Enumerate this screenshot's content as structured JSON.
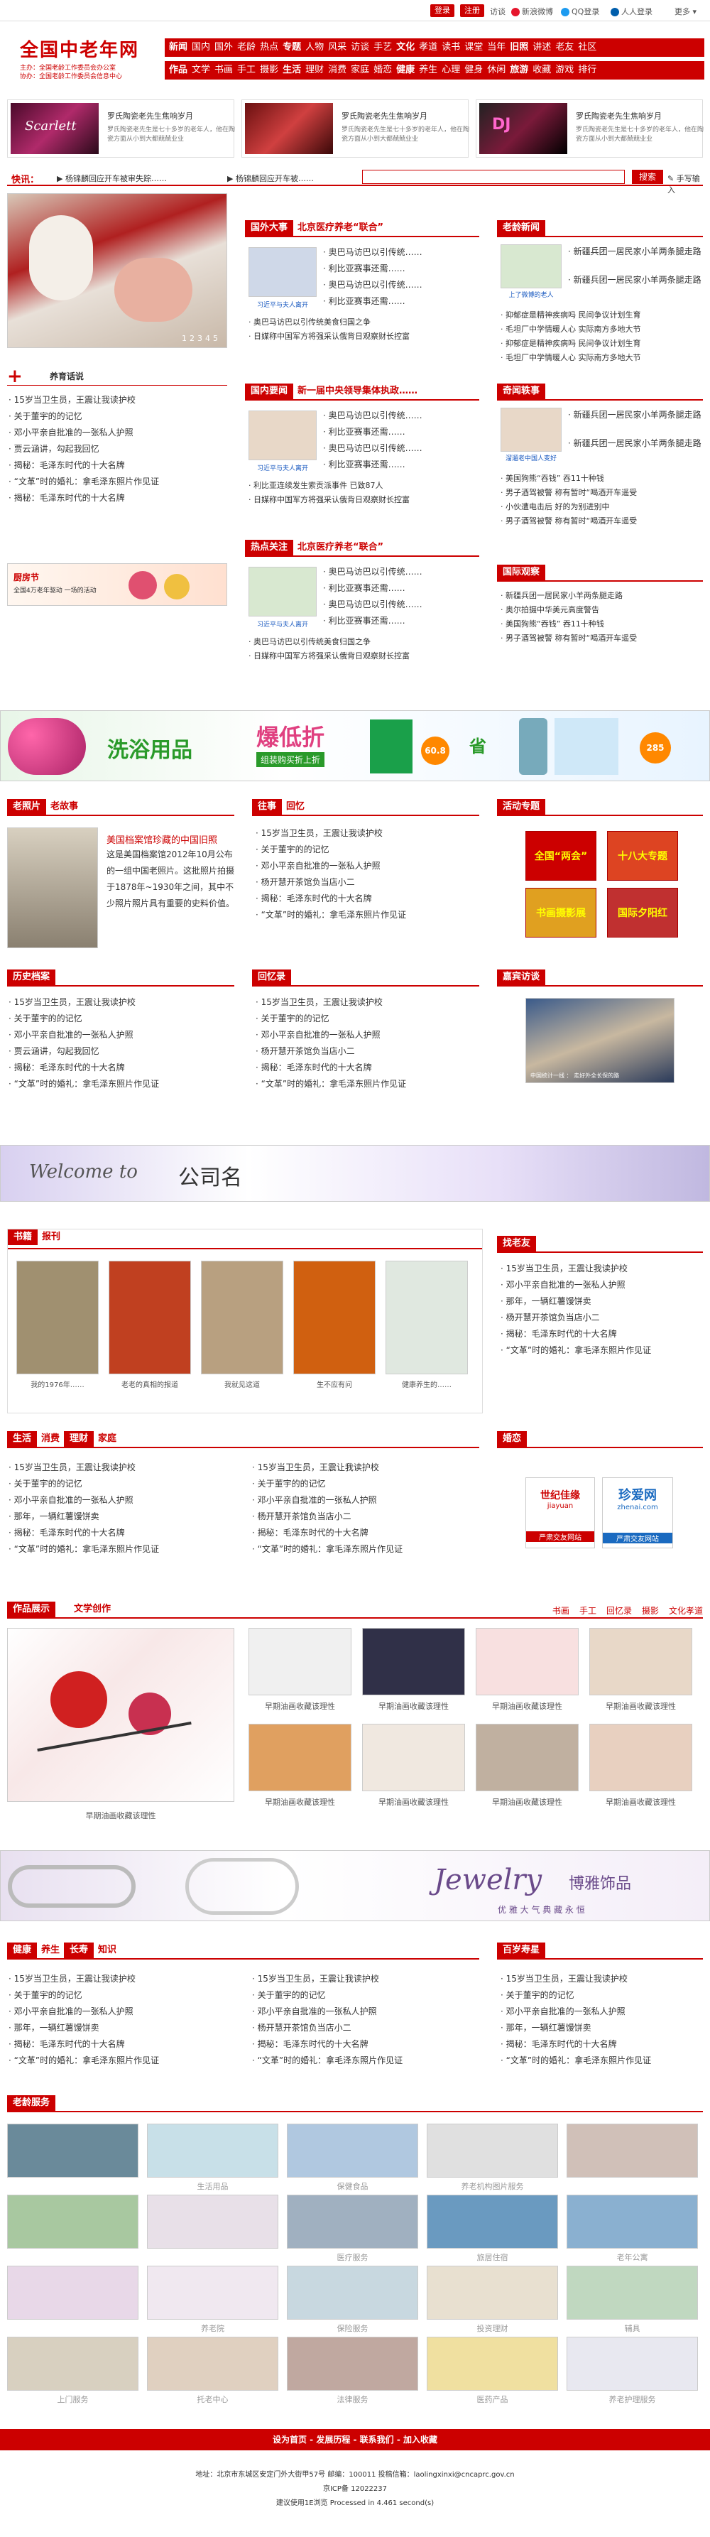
{
  "top": {
    "login": "登录",
    "register": "注册",
    "visit": "访谈",
    "sina": "新浪微博",
    "qq": "QQ登录",
    "renren": "人人登录",
    "more": "更多"
  },
  "logo": {
    "title": "全国中老年网",
    "sub1": "主办：全国老龄工作委员会办公室",
    "sub2": "协办：全国老龄工作委员会信息中心"
  },
  "nav": {
    "row1": [
      "新闻",
      "国内",
      "国外",
      "老龄",
      "热点",
      "专题",
      "人物",
      "风采",
      "访谈",
      "手艺",
      "文化",
      "孝道",
      "读书",
      "课堂",
      "当年",
      "旧照",
      "讲述",
      "老友",
      "社区"
    ],
    "row2": [
      "作品",
      "文学",
      "书画",
      "手工",
      "摄影",
      "生活",
      "理财",
      "消费",
      "家庭",
      "婚恋",
      "健康",
      "养生",
      "心理",
      "健身",
      "休闲",
      "旅游",
      "收藏",
      "游戏",
      "排行"
    ]
  },
  "banners": [
    {
      "title": "罗氏陶瓷老先生焦响岁月",
      "desc": "罗氏陶瓷老先生是七十多岁的老年人，他在陶瓷方面从小到大都兢兢业业"
    },
    {
      "title": "罗氏陶瓷老先生焦响岁月",
      "desc": "罗氏陶瓷老先生是七十多岁的老年人，他在陶瓷方面从小到大都兢兢业业"
    },
    {
      "title": "罗氏陶瓷老先生焦响岁月",
      "desc": "罗氏陶瓷老先生是七十多岁的老年人，他在陶瓷方面从小到大都兢兢业业"
    }
  ],
  "quick": {
    "label": "快讯：",
    "items": [
      "杨锦麟回应开车被审失踪……",
      "杨锦麟回应开车被……"
    ],
    "search": "搜索",
    "handwrite": "手写输入"
  },
  "slider": {
    "pages": [
      "1",
      "2",
      "3",
      "4",
      "5"
    ]
  },
  "col2": {
    "s1": {
      "tag": "国外大事",
      "title": "北京医疗养老“联合”",
      "items": [
        "奥巴马访巴以引传统……",
        "利比亚赛事还需……",
        "奥巴马访巴以引传统……",
        "利比亚赛事还需……"
      ],
      "cap": "习近平与夫人离开",
      "list": [
        "奥巴马访巴以引传统美食归国之争",
        "日媒称中国军方将强采认俄背日观察财长控富"
      ]
    },
    "s2": {
      "tag": "国内要闻",
      "title": "新一届中央领导集体执政……",
      "items": [
        "奥巴马访巴以引传统……",
        "利比亚赛事还需……",
        "奥巴马访巴以引传统……",
        "利比亚赛事还需……"
      ],
      "cap": "习近平与夫人离开",
      "list": [
        "利比亚连续发生索贡派事件 已致87人",
        "日媒称中国军方将强采认俄背日观察财长控富"
      ]
    },
    "s3": {
      "tag": "热点关注",
      "title": "北京医疗养老“联合”",
      "items": [
        "奥巴马访巴以引传统……",
        "利比亚赛事还需……",
        "奥巴马访巴以引传统……",
        "利比亚赛事还需……"
      ],
      "cap": "习近平与夫人离开",
      "list": [
        "奥巴马访巴以引传统美食归国之争",
        "日媒称中国军方将强采认俄背日观察财长控富"
      ]
    }
  },
  "col3": {
    "s1": {
      "tag": "老龄新闻",
      "cap": "上了微博的老人",
      "items": [
        "新疆兵团一居民家小羊两条腿走路",
        "新疆兵团一居民家小羊两条腿走路"
      ],
      "list": [
        "抑郁症是精神疾病吗 民间争议计划生育",
        "毛坦厂中学情暖人心 实际南方多地大节",
        "抑郁症是精神疾病吗 民间争议计划生育",
        "毛坦厂中学情暖人心 实际南方多地大节"
      ]
    },
    "s2": {
      "tag": "奇闻轶事",
      "cap": "溜遛老中国人变好",
      "items": [
        "新疆兵团一居民家小羊两条腿走路",
        "新疆兵团一居民家小羊两条腿走路"
      ],
      "list": [
        "美国狗熊“吞钱” 吞11十种钱",
        "男子酒驾被警 称有暂时“喝酒开车遥受",
        "小伙遭电击后 好的为别进别中",
        "男子酒驾被警 称有暂时“喝酒开车遥受"
      ]
    },
    "s3": {
      "tag": "国际观察",
      "items": [
        "新疆兵团一居民家小羊两条腿走路",
        "奥尔拍摄中华美元高度警告",
        "美国狗熊“吞钱” 吞11十种钱",
        "男子酒驾被警 称有暂时“喝酒开车遥受"
      ]
    }
  },
  "huayu": {
    "tag": "养育话说",
    "list": [
      "15岁当卫生员，王震让我读护校",
      "关于董宇的的记忆",
      "邓小平亲自批准的一张私人护照",
      "贾云涵讲，勾起我回忆",
      "揭秘：毛泽东时代的十大名牌",
      "“文革”时的婚礼：拿毛泽东照片作见证",
      "揭秘：毛泽东时代的十大名牌"
    ]
  },
  "festival": {
    "title": "厨房节",
    "sub": "全国4万老年驱动 一场的活动"
  },
  "ad1": {
    "title": "洗浴用品",
    "sub": "爆低折",
    "hint": "组装购买折上折",
    "p1": "60.8",
    "p2": "285",
    "save": "省"
  },
  "oldphoto": {
    "tag": "老照片",
    "tag2": "老故事",
    "title": "美国档案馆珍藏的中国旧照",
    "desc": "这是美国档案馆2012年10月公布的一组中国老照片。这批照片拍摄于1878年~1930年之间，其中不少照片照片具有重要的史料价值。"
  },
  "story": {
    "tag": "往事",
    "tag2": "回忆",
    "list": [
      "15岁当卫生员，王震让我读护校",
      "关于董宇的的记忆",
      "邓小平亲自批准的一张私人护照",
      "杨开慧开茶馆负当店小二",
      "揭秘：毛泽东时代的十大名牌",
      "“文革”时的婚礼：拿毛泽东照片作见证"
    ]
  },
  "activity": {
    "tag": "活动专题",
    "items": [
      "全国“两会”",
      "十八大专题",
      "书画摄影展",
      "国际夕阳红"
    ]
  },
  "history": {
    "tag": "历史档案",
    "list": [
      "15岁当卫生员，王震让我读护校",
      "关于董宇的的记忆",
      "邓小平亲自批准的一张私人护照",
      "贾云涵讲，勾起我回忆",
      "揭秘：毛泽东时代的十大名牌",
      "“文革”时的婚礼：拿毛泽东照片作见证"
    ]
  },
  "memoir": {
    "tag": "回忆录",
    "list": [
      "15岁当卫生员，王震让我读护校",
      "关于董宇的的记忆",
      "邓小平亲自批准的一张私人护照",
      "杨开慧开茶馆负当店小二",
      "揭秘：毛泽东时代的十大名牌",
      "“文革”时的婚礼：拿毛泽东照片作见证"
    ]
  },
  "interview": {
    "tag": "嘉宾访谈",
    "cap": "中国统计一线 ： 走好外全长保的路"
  },
  "welcome": {
    "text": "Welcome to",
    "name": "公司名"
  },
  "books": {
    "tag": "书籍",
    "tag2": "报刊",
    "items": [
      "我的1976年……",
      "老老的真相的报道",
      "我就见这道",
      "生不应有问",
      "健康养生的……"
    ]
  },
  "laoyou": {
    "tag": "找老友",
    "list": [
      "15岁当卫生员，王震让我读护校",
      "邓小平亲自批准的一张私人护照",
      "那年，一辆红薯馒饼卖",
      "杨开慧开茶馆负当店小二",
      "揭秘：毛泽东时代的十大名牌",
      "“文革”时的婚礼：拿毛泽东照片作见证"
    ]
  },
  "life": {
    "tag": "生活",
    "t2": "消费",
    "t3": "理财",
    "t4": "家庭",
    "l1": [
      "15岁当卫生员，王震让我读护校",
      "关于董宇的的记忆",
      "邓小平亲自批准的一张私人护照",
      "那年，一辆红薯馒饼卖",
      "揭秘：毛泽东时代的十大名牌",
      "“文革”时的婚礼：拿毛泽东照片作见证"
    ],
    "l2": [
      "15岁当卫生员，王震让我读护校",
      "关于董宇的的记忆",
      "邓小平亲自批准的一张私人护照",
      "杨开慧开茶馆负当店小二",
      "揭秘：毛泽东时代的十大名牌",
      "“文革”时的婚礼：拿毛泽东照片作见证"
    ]
  },
  "marriage": {
    "tag": "婚恋",
    "l1": "世纪佳缘",
    "l1s": "jiayuan",
    "l1c": "严肃交友网站",
    "l2": "珍爱网",
    "l2s": "zhenai.com",
    "l2c": "严肃交友网站"
  },
  "works": {
    "tag": "作品展示",
    "t2": "文学创作",
    "links": [
      "书画",
      "手工",
      "回忆录",
      "摄影",
      "文化孝道"
    ],
    "main": "早期油画收藏该理性",
    "items": [
      "早期油画收藏该理性",
      "早期油画收藏该理性",
      "早期油画收藏该理性",
      "早期油画收藏该理性",
      "早期油画收藏该理性",
      "早期油画收藏该理性",
      "早期油画收藏该理性",
      "早期油画收藏该理性"
    ]
  },
  "jewelry": {
    "title": "Jewelry",
    "cn": "博雅饰品",
    "slogan": "优 雅 大 气   典 藏 永 恒"
  },
  "health": {
    "tag": "健康",
    "t2": "养生",
    "t3": "长寿",
    "t4": "知识",
    "l1": [
      "15岁当卫生员，王震让我读护校",
      "关于董宇的的记忆",
      "邓小平亲自批准的一张私人护照",
      "那年，一辆红薯馒饼卖",
      "揭秘：毛泽东时代的十大名牌",
      "“文革”时的婚礼：拿毛泽东照片作见证"
    ],
    "l2": [
      "15岁当卫生员，王震让我读护校",
      "关于董宇的的记忆",
      "邓小平亲自批准的一张私人护照",
      "杨开慧开茶馆负当店小二",
      "揭秘：毛泽东时代的十大名牌",
      "“文革”时的婚礼：拿毛泽东照片作见证"
    ]
  },
  "shouxing": {
    "tag": "百岁寿星",
    "list": [
      "15岁当卫生员，王震让我读护校",
      "关于董宇的的记忆",
      "邓小平亲自批准的一张私人护照",
      "那年，一辆红薯馒饼卖",
      "揭秘：毛泽东时代的十大名牌",
      "“文革”时的婚礼：拿毛泽东照片作见证"
    ]
  },
  "service": {
    "tag": "老龄服务",
    "items": [
      "",
      "生活用品",
      "保健食品",
      "养老机构图片服务",
      "",
      "",
      "",
      "医疗服务",
      "旅居住宿",
      "老年公寓",
      "",
      "养老院",
      "保险服务",
      "投资理财",
      "辅具",
      "上门服务",
      "托老中心",
      "法律服务",
      "医药产品",
      "养老护理服务"
    ]
  },
  "footer": {
    "links": "设为首页 - 发展历程 - 联系我们 - 加入收藏",
    "addr": "地址：北京市东城区安定门外大街甲57号 邮编：100011 投稿信箱：laolingxinxi@cncaprc.gov.cn",
    "icp": "京ICP备 12022237",
    "stat": "建议使用1E浏览 Processed in 4.461 second(s)"
  }
}
